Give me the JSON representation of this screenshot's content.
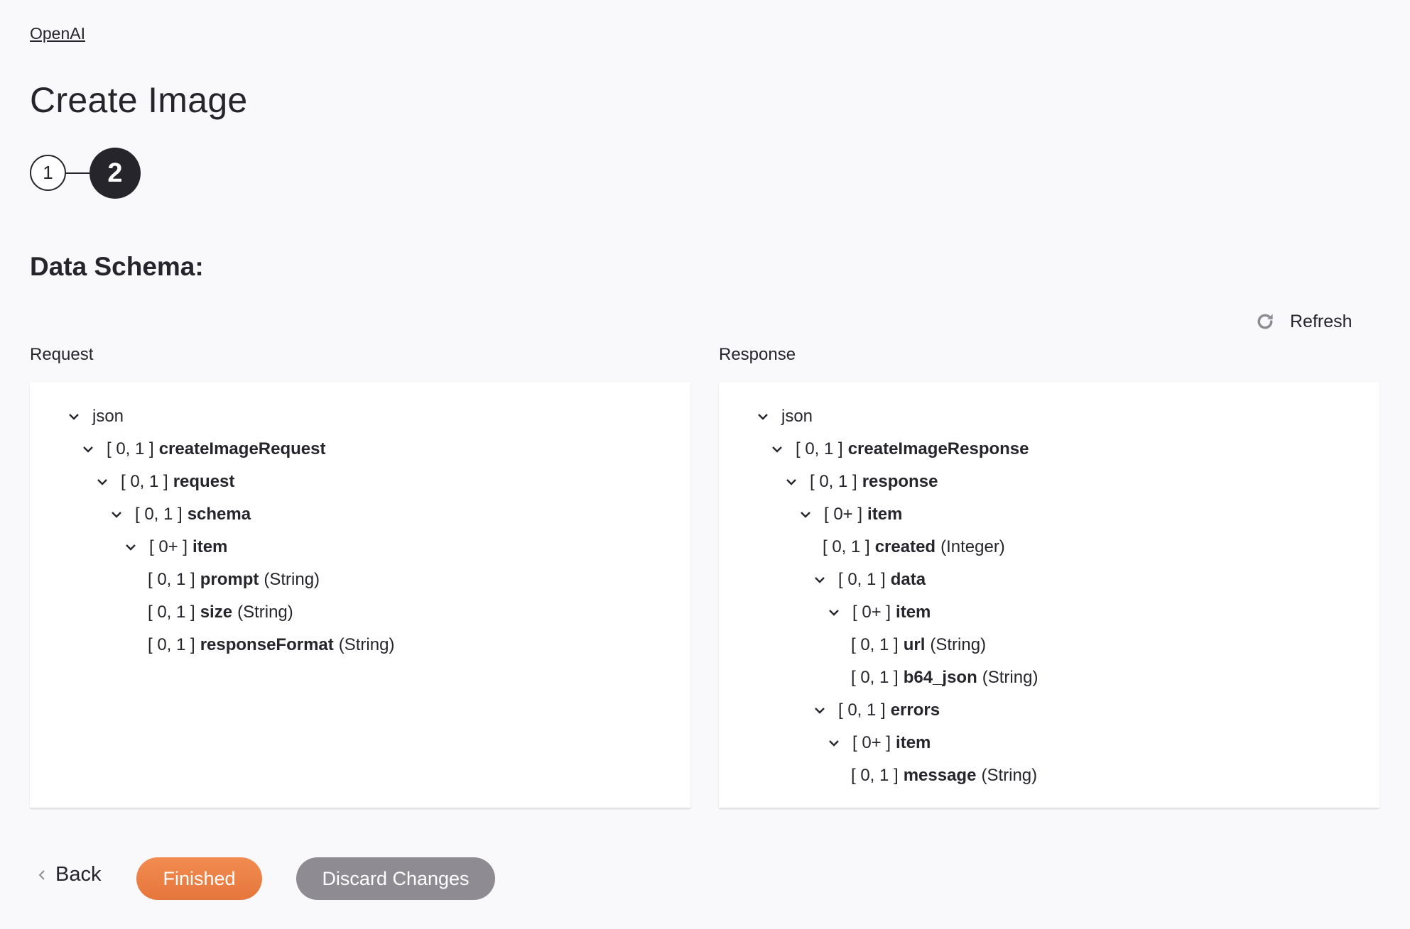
{
  "breadcrumb": "OpenAI",
  "page_title": "Create Image",
  "stepper": {
    "steps": [
      "1",
      "2"
    ],
    "current": 2
  },
  "section_title": "Data Schema:",
  "refresh_label": "Refresh",
  "request": {
    "label": "Request",
    "nodes": [
      {
        "level": 0,
        "expand": true,
        "card": "",
        "name": "json",
        "type": ""
      },
      {
        "level": 1,
        "expand": true,
        "card": "[ 0, 1 ]",
        "name": "createImageRequest",
        "type": ""
      },
      {
        "level": 2,
        "expand": true,
        "card": "[ 0, 1 ]",
        "name": "request",
        "type": ""
      },
      {
        "level": 3,
        "expand": true,
        "card": "[ 0, 1 ]",
        "name": "schema",
        "type": ""
      },
      {
        "level": 4,
        "expand": true,
        "card": "[ 0+ ]",
        "name": "item",
        "type": ""
      },
      {
        "level": 5,
        "expand": false,
        "card": "[ 0, 1 ]",
        "name": "prompt",
        "type": "(String)"
      },
      {
        "level": 5,
        "expand": false,
        "card": "[ 0, 1 ]",
        "name": "size",
        "type": "(String)"
      },
      {
        "level": 5,
        "expand": false,
        "card": "[ 0, 1 ]",
        "name": "responseFormat",
        "type": "(String)"
      }
    ]
  },
  "response": {
    "label": "Response",
    "nodes": [
      {
        "level": 0,
        "expand": true,
        "card": "",
        "name": "json",
        "type": ""
      },
      {
        "level": 1,
        "expand": true,
        "card": "[ 0, 1 ]",
        "name": "createImageResponse",
        "type": ""
      },
      {
        "level": 2,
        "expand": true,
        "card": "[ 0, 1 ]",
        "name": "response",
        "type": ""
      },
      {
        "level": 3,
        "expand": true,
        "card": "[ 0+ ]",
        "name": "item",
        "type": ""
      },
      {
        "level": 4,
        "expand": false,
        "card": "[ 0, 1 ]",
        "name": "created",
        "type": "(Integer)"
      },
      {
        "level": 4,
        "expand": true,
        "card": "[ 0, 1 ]",
        "name": "data",
        "type": ""
      },
      {
        "level": 5,
        "expand": true,
        "card": "[ 0+ ]",
        "name": "item",
        "type": ""
      },
      {
        "level": 6,
        "expand": false,
        "card": "[ 0, 1 ]",
        "name": "url",
        "type": "(String)"
      },
      {
        "level": 6,
        "expand": false,
        "card": "[ 0, 1 ]",
        "name": "b64_json",
        "type": "(String)"
      },
      {
        "level": 4,
        "expand": true,
        "card": "[ 0, 1 ]",
        "name": "errors",
        "type": ""
      },
      {
        "level": 5,
        "expand": true,
        "card": "[ 0+ ]",
        "name": "item",
        "type": ""
      },
      {
        "level": 6,
        "expand": false,
        "card": "[ 0, 1 ]",
        "name": "message",
        "type": "(String)"
      }
    ]
  },
  "footer": {
    "back_label": "Back",
    "finished_label": "Finished",
    "discard_label": "Discard Changes"
  },
  "colors": {
    "primary": "#e87d43",
    "secondary": "#8e8c92",
    "text": "#26252b"
  }
}
